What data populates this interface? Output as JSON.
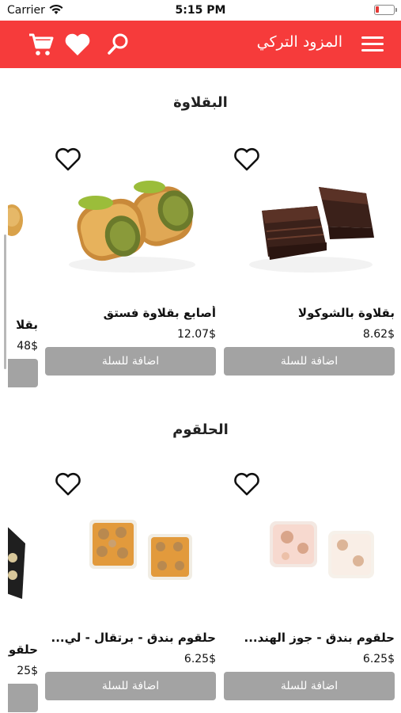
{
  "status": {
    "carrier": "Carrier",
    "time": "5:15 PM"
  },
  "nav": {
    "title": "المزود التركي"
  },
  "colors": {
    "nav_bg": "#f63b3b",
    "button_bg": "#a3a3a3"
  },
  "sections": [
    {
      "title": "البقلاوة",
      "partial": {
        "name": "بقلا",
        "price": "48$"
      },
      "products": [
        {
          "name": "أصابع بقلاوة فستق",
          "price": "12.07$",
          "button": "اضافة للسلة"
        },
        {
          "name": "بقلاوة بالشوكولا",
          "price": "8.62$",
          "button": "اضافة للسلة"
        }
      ]
    },
    {
      "title": "الحلقوم",
      "partial": {
        "name": "حلقو",
        "price": "25$"
      },
      "products": [
        {
          "name": "حلقوم بندق - برتقال - لي...",
          "price": "6.25$",
          "button": "اضافة للسلة"
        },
        {
          "name": "حلقوم بندق - جوز الهند...",
          "price": "6.25$",
          "button": "اضافة للسلة"
        }
      ]
    }
  ]
}
